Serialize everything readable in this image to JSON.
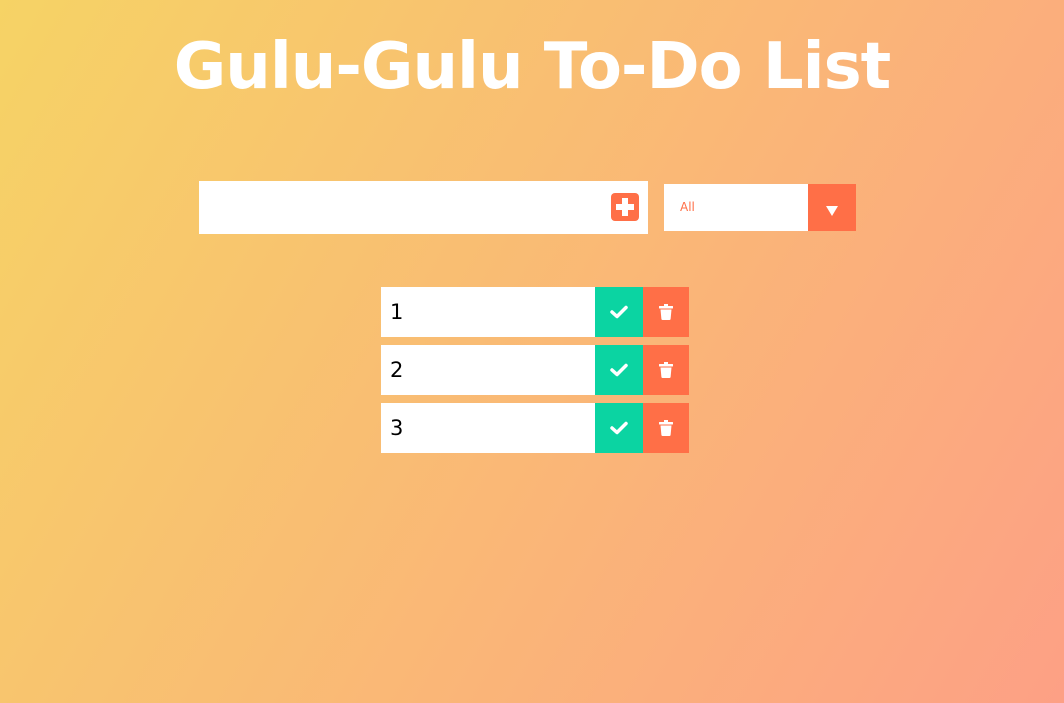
{
  "header": {
    "title": "Gulu-Gulu To-Do List"
  },
  "form": {
    "input_value": "",
    "add_icon": "plus-square-icon"
  },
  "filter": {
    "selected": "All",
    "arrow_icon": "caret-down-icon"
  },
  "todos": [
    {
      "text": "1",
      "complete_icon": "check-icon",
      "delete_icon": "trash-icon"
    },
    {
      "text": "2",
      "complete_icon": "check-icon",
      "delete_icon": "trash-icon"
    },
    {
      "text": "3",
      "complete_icon": "check-icon",
      "delete_icon": "trash-icon"
    }
  ],
  "colors": {
    "gradient_start": "#f6d365",
    "gradient_end": "#fda085",
    "accent": "#ff6f47",
    "complete": "#0bd4a2"
  }
}
